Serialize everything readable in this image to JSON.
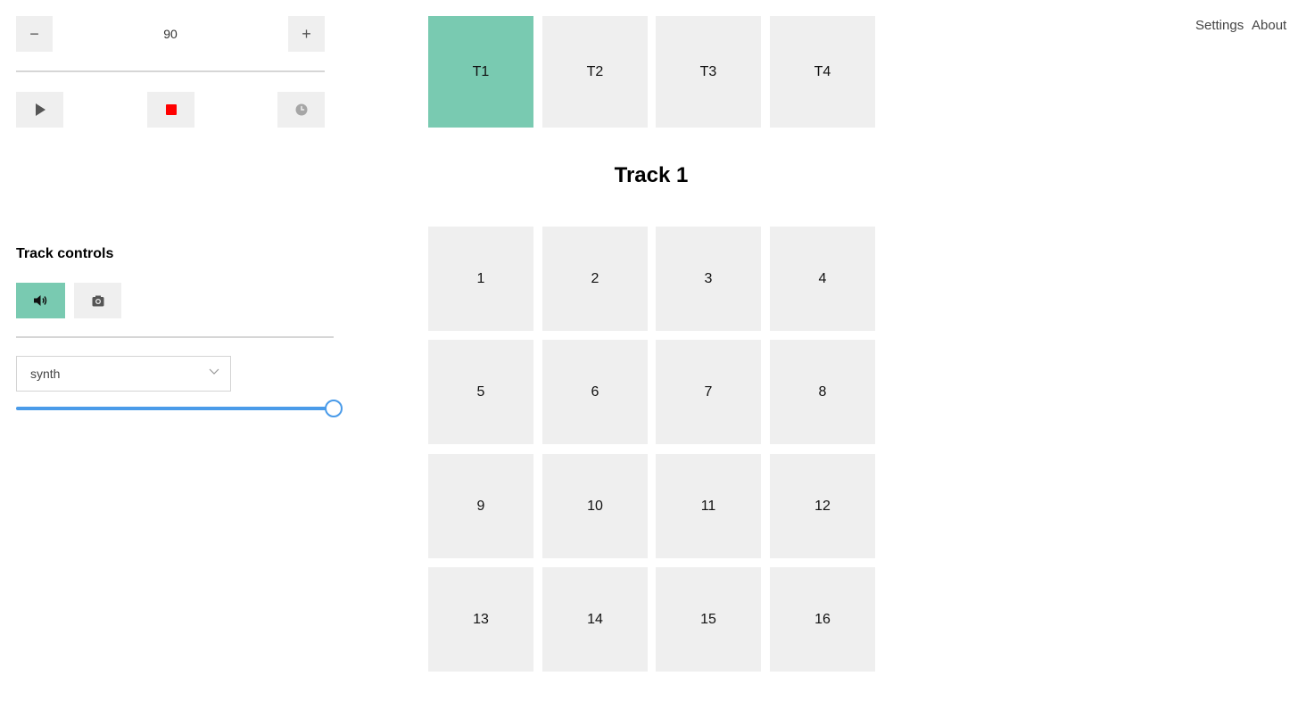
{
  "tempo": {
    "decrement_label": "−",
    "value": "90",
    "increment_label": "+"
  },
  "transport": {
    "play_icon": "play-icon",
    "stop_icon": "stop-icon",
    "metronome_icon": "clock-icon",
    "stop_color": "#ff0000"
  },
  "tracks": {
    "tabs": [
      {
        "label": "T1",
        "active": true
      },
      {
        "label": "T2",
        "active": false
      },
      {
        "label": "T3",
        "active": false
      },
      {
        "label": "T4",
        "active": false
      }
    ],
    "current_title": "Track 1",
    "active_color": "#79cab1"
  },
  "pads": [
    "1",
    "2",
    "3",
    "4",
    "5",
    "6",
    "7",
    "8",
    "9",
    "10",
    "11",
    "12",
    "13",
    "14",
    "15",
    "16"
  ],
  "nav": {
    "settings": "Settings",
    "about": "About"
  },
  "track_controls": {
    "heading": "Track controls",
    "sound_icon": "speaker-icon",
    "record_icon": "camera-icon",
    "instrument_selected": "synth",
    "volume": 1.0,
    "accent_color": "#4a9be9"
  }
}
